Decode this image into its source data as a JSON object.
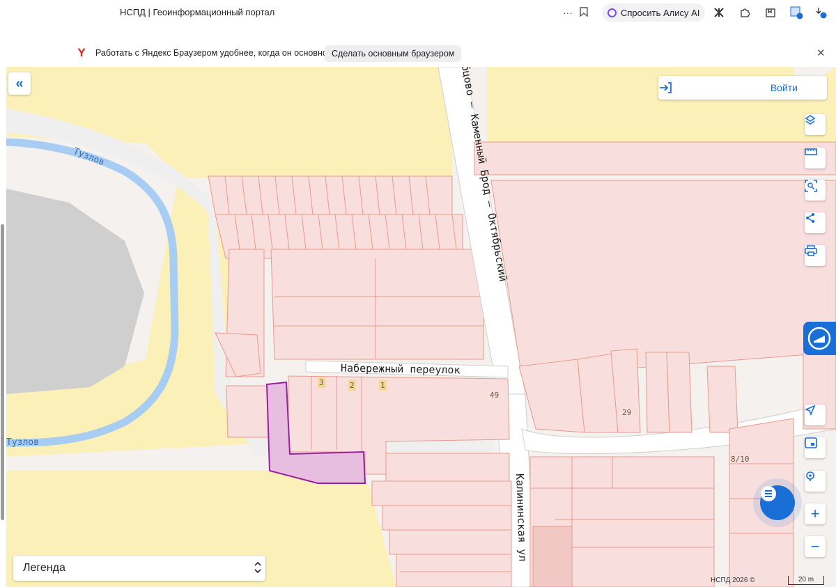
{
  "browser": {
    "tab_title": "НСПД | Геоинформационный портал",
    "more_label": "···",
    "alice_label": "Спросить Алису AI",
    "colors": {
      "accent": "#1a6fd6"
    }
  },
  "infobar": {
    "message": "Работать с Яндекс Браузером удобнее, когда он основной",
    "make_default_label": "Сделать основным браузером",
    "logo_letter": "Y",
    "close_label": "✕"
  },
  "map": {
    "login_label": "Войти",
    "collapse_label": "«",
    "streets": {
      "tuzlov_top": "Тузлов",
      "tuzlov_bottom": "Тузлов",
      "naberezhny": "Набережный переулок",
      "kamenny_brod": "бцово – Каменный Брод – Октябрьский",
      "kalininskaya": "Калининская ул"
    },
    "house_numbers": [
      "3",
      "2",
      "1",
      "49",
      "29",
      "8/10"
    ],
    "legend_label": "Легенда",
    "legend_chevron": "⌃⌄",
    "copyright": "НСПД 2026 ©",
    "scale_label": "20 m",
    "zoom_in": "+",
    "zoom_out": "−",
    "controls": [
      "layers-icon",
      "ruler-icon",
      "select-area-icon",
      "share-icon",
      "print-icon",
      "locate-icon",
      "minimap-icon",
      "pin-search-icon"
    ],
    "colors": {
      "parcel_fill": "#f9dede",
      "parcel_stroke": "#e99a8a",
      "highlight_fill": "#e7bde0",
      "highlight_stroke": "#9a1fa0",
      "water": "#a8cdf3",
      "zone_yellow": "#fbf0b8"
    }
  }
}
